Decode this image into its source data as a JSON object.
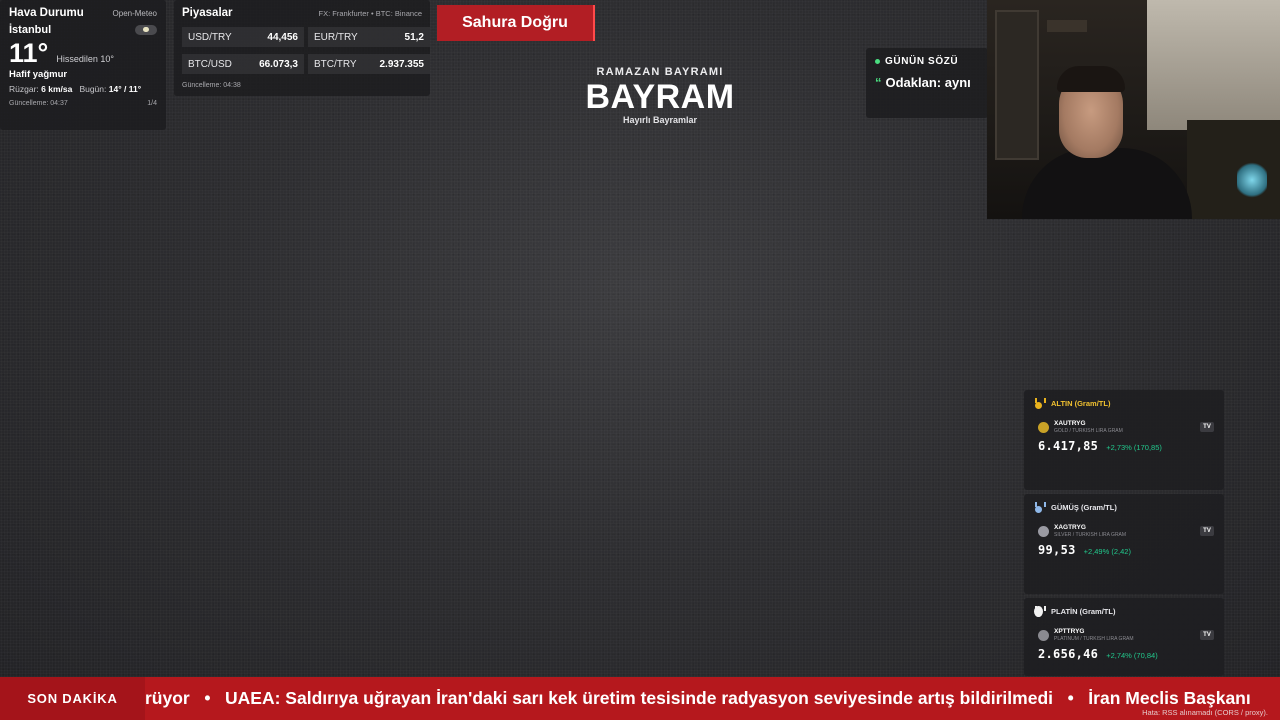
{
  "weather": {
    "title": "Hava Durumu",
    "source": "Open-Meteo",
    "city": "İstanbul",
    "temp": "11°",
    "feels": "Hissedilen 10°",
    "condition": "Hafif yağmur",
    "wind_label": "Rüzgar:",
    "wind_value": "6 km/sa",
    "today_label": "Bugün:",
    "today_value": "14° / 11°",
    "updated": "Güncelleme: 04:37",
    "page": "1/4",
    "icon": "cloud-sun-icon"
  },
  "markets": {
    "title": "Piyasalar",
    "source": "FX: Frankfurter • BTC: Binance",
    "items": [
      {
        "symbol": "USD/TRY",
        "value": "44,456"
      },
      {
        "symbol": "EUR/TRY",
        "value": "51,2"
      },
      {
        "symbol": "BTC/USD",
        "value": "66.073,3"
      },
      {
        "symbol": "BTC/TRY",
        "value": "2.937.355"
      }
    ],
    "updated": "Güncelleme: 04:38"
  },
  "sahur": {
    "label": "Sahura Doğru"
  },
  "bayram": {
    "small": "RAMAZAN BAYRAMI",
    "big": "BAYRAM",
    "sub": "Hayırlı Bayramlar"
  },
  "quote": {
    "label": "GÜNÜN SÖZÜ",
    "mark": "“",
    "text": "Odaklan: aynı"
  },
  "metals": [
    {
      "title": "ALTIN (Gram/TL)",
      "ticker": "XAUTRYG",
      "desc": "GOLD / TURKISH LIRA GRAM",
      "price": "6.417,85",
      "change": "+2,73% (170,85)",
      "color": "#e8b21e",
      "title_color": "#f2c230",
      "coin": "#c9a227"
    },
    {
      "title": "GÜMÜŞ (Gram/TL)",
      "ticker": "XAGTRYG",
      "desc": "SILVER / TURKISH LIRA GRAM",
      "price": "99,53",
      "change": "+2,49% (2,42)",
      "color": "#8fb8e8",
      "title_color": "#e8e8ec",
      "coin": "#9a9aa2"
    },
    {
      "title": "PLATİN (Gram/TL)",
      "ticker": "XPTTRYG",
      "desc": "PLATINUM / TURKISH LIRA GRAM",
      "price": "2.656,46",
      "change": "+2,74% (70,84)",
      "color": "#f2f2f2",
      "title_color": "#e8e8ec",
      "coin": "#8a8a90"
    }
  ],
  "ticker": {
    "label": "SON DAKİKA",
    "text": "rüyor   •   UAEA: Saldırıya uğrayan İran'daki sarı kek üretim tesisinde radyasyon seviyesinde artış bildirilmedi   •   İran Meclis Başkanı",
    "error": "Hata: RSS alınamadı (CORS / proxy)."
  },
  "colors": {
    "accent_red": "#b5181d",
    "positive": "#22c88c",
    "quote_dot": "#4ade80"
  }
}
